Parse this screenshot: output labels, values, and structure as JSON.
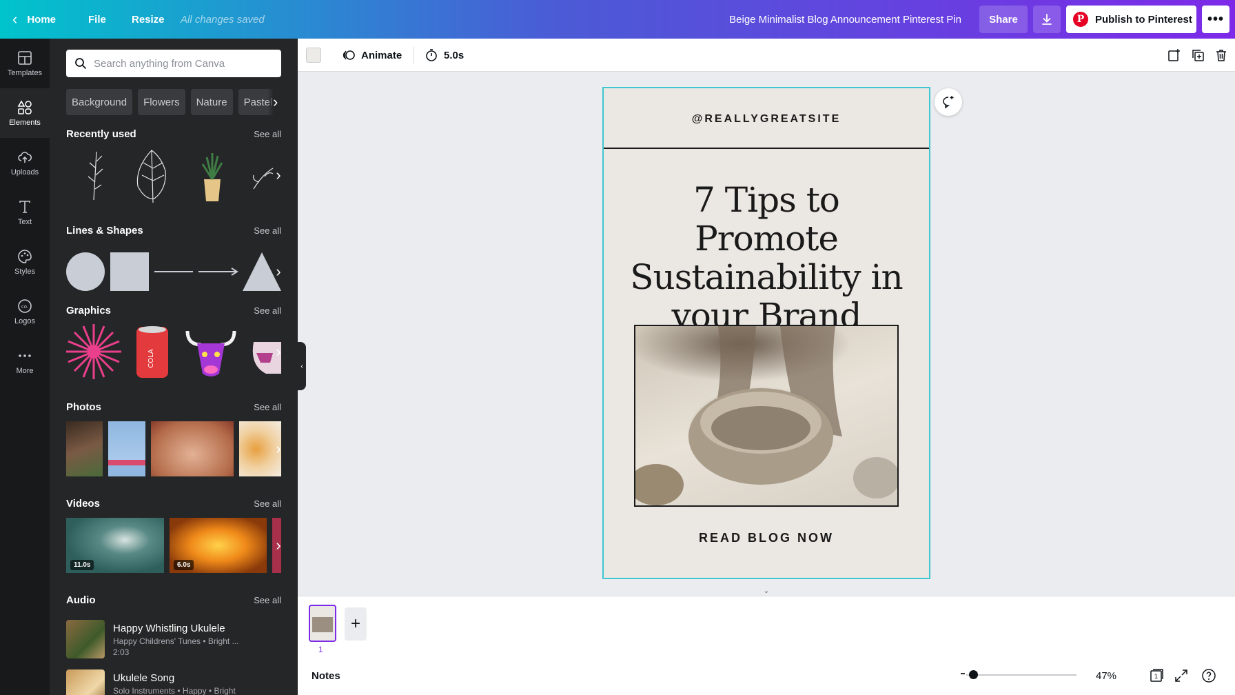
{
  "topbar": {
    "home": "Home",
    "file": "File",
    "resize": "Resize",
    "saved_status": "All changes saved",
    "doc_title": "Beige Minimalist Blog Announcement Pinterest Pin",
    "share": "Share",
    "publish": "Publish to Pinterest",
    "more": "•••",
    "gradient_start": "#00c4cc",
    "gradient_end": "#7d2ae8"
  },
  "rail": {
    "items": [
      {
        "label": "Templates",
        "icon": "templates-icon"
      },
      {
        "label": "Elements",
        "icon": "elements-icon",
        "active": true
      },
      {
        "label": "Uploads",
        "icon": "upload-cloud-icon"
      },
      {
        "label": "Text",
        "icon": "text-t-icon"
      },
      {
        "label": "Styles",
        "icon": "palette-icon"
      },
      {
        "label": "Logos",
        "icon": "logo-icon"
      },
      {
        "label": "More",
        "icon": "more-dots-icon"
      }
    ]
  },
  "panel": {
    "search_placeholder": "Search anything from Canva",
    "chips": [
      "Background",
      "Flowers",
      "Nature",
      "Pastel b"
    ],
    "sections": {
      "recently_used": {
        "title": "Recently used",
        "see_all": "See all"
      },
      "lines_shapes": {
        "title": "Lines & Shapes",
        "see_all": "See all"
      },
      "graphics": {
        "title": "Graphics",
        "see_all": "See all"
      },
      "photos": {
        "title": "Photos",
        "see_all": "See all"
      },
      "videos": {
        "title": "Videos",
        "see_all": "See all",
        "durations": [
          "11.0s",
          "6.0s"
        ]
      },
      "audio": {
        "title": "Audio",
        "see_all": "See all"
      }
    },
    "audio_tracks": [
      {
        "title": "Happy Whistling Ukulele",
        "meta": "Happy Childrens' Tunes • Bright ...",
        "duration": "2:03"
      },
      {
        "title": "Ukulele Song",
        "meta": "Solo Instruments • Happy • Bright",
        "duration": ""
      }
    ]
  },
  "toolbar": {
    "animate": "Animate",
    "duration": "5.0s",
    "swatch_color": "#ecebe8"
  },
  "design": {
    "handle": "@REALLYGREATSITE",
    "headline_line1": "7 Tips to Promote",
    "headline_line2": "Sustainability in",
    "headline_line3": "your Brand",
    "cta": "READ BLOG NOW",
    "background": "#ebe8e3",
    "selection_color": "#3ec6d1"
  },
  "pages": {
    "current": "1"
  },
  "bottombar": {
    "notes": "Notes",
    "zoom": "47%",
    "zoom_level": 0.47
  }
}
